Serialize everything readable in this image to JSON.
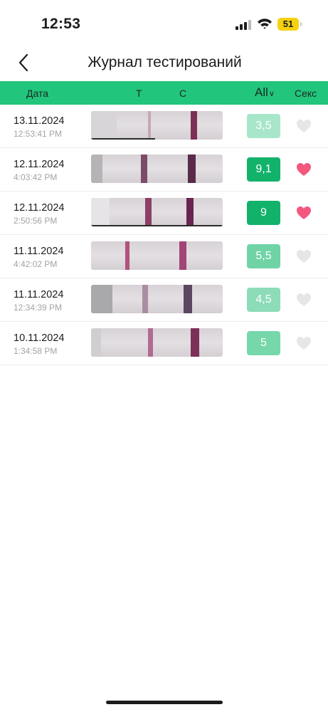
{
  "status_bar": {
    "time": "12:53",
    "battery": "51",
    "battery_color": "#f5d10f"
  },
  "nav": {
    "title": "Журнал тестирований",
    "back_icon": "chevron-left-icon"
  },
  "header": {
    "date": "Дата",
    "t": "Т",
    "c": "С",
    "filter": "All",
    "filter_icon": "chevron-down-icon",
    "sex": "Секс",
    "bg_color": "#22c57c"
  },
  "rows": [
    {
      "date": "13.11.2024",
      "time": "12:53:41 PM",
      "value": "3,5",
      "badge_color": "#a8e6c9",
      "heart_active": false,
      "t_intensity": "faint"
    },
    {
      "date": "12.11.2024",
      "time": "4:03:42 PM",
      "value": "9,1",
      "badge_color": "#12b26b",
      "heart_active": true,
      "t_intensity": "strong"
    },
    {
      "date": "12.11.2024",
      "time": "2:50:56 PM",
      "value": "9",
      "badge_color": "#12b26b",
      "heart_active": true,
      "t_intensity": "strong"
    },
    {
      "date": "11.11.2024",
      "time": "4:42:02 PM",
      "value": "5,5",
      "badge_color": "#6fd3a6",
      "heart_active": false,
      "t_intensity": "medium"
    },
    {
      "date": "11.11.2024",
      "time": "12:34:39 PM",
      "value": "4,5",
      "badge_color": "#8ddcb8",
      "heart_active": false,
      "t_intensity": "light"
    },
    {
      "date": "10.11.2024",
      "time": "1:34:58 PM",
      "value": "5",
      "badge_color": "#76d7ab",
      "heart_active": false,
      "t_intensity": "medium"
    }
  ],
  "heart_colors": {
    "active": "#f4587e",
    "inactive": "#e6e6e6"
  }
}
